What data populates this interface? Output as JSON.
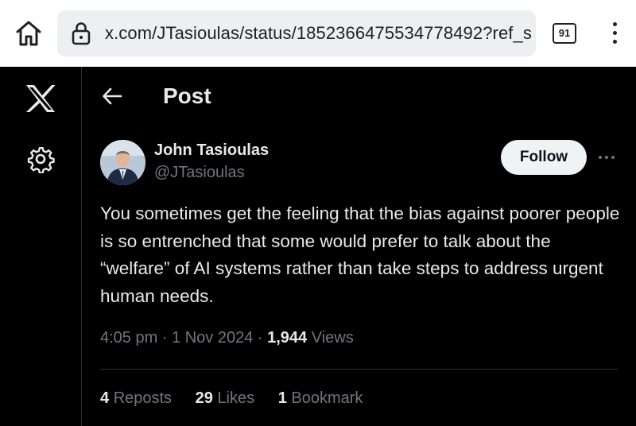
{
  "browser": {
    "url": "x.com/JTasioulas/status/1852366475534778492?ref_s",
    "tab_count": "91"
  },
  "header": {
    "title": "Post"
  },
  "post": {
    "author_name": "John Tasioulas",
    "author_handle": "@JTasioulas",
    "follow_label": "Follow",
    "text": "You sometimes get the feeling that the bias against poorer people is so entrenched that some would prefer to talk about the “welfare” of AI systems rather than take steps to address urgent human needs.",
    "time": "4:05 pm",
    "date": "1 Nov 2024",
    "views_count": "1,944",
    "views_label": "Views",
    "reposts_count": "4",
    "reposts_label": "Reposts",
    "likes_count": "29",
    "likes_label": "Likes",
    "bookmarks_count": "1",
    "bookmarks_label": "Bookmark"
  },
  "icons": {
    "home": "home-icon",
    "lock": "lock-icon",
    "menu": "more-vertical-icon",
    "logo": "x-logo-icon",
    "settings": "gear-icon",
    "back": "arrow-left-icon",
    "more": "more-horizontal-icon"
  },
  "colors": {
    "background": "#000000",
    "text_primary": "#e7e9ea",
    "text_secondary": "#71767b",
    "follow_bg": "#eff3f4",
    "browser_chrome": "#ffffff",
    "urlbar_bg": "#eeeff3"
  }
}
